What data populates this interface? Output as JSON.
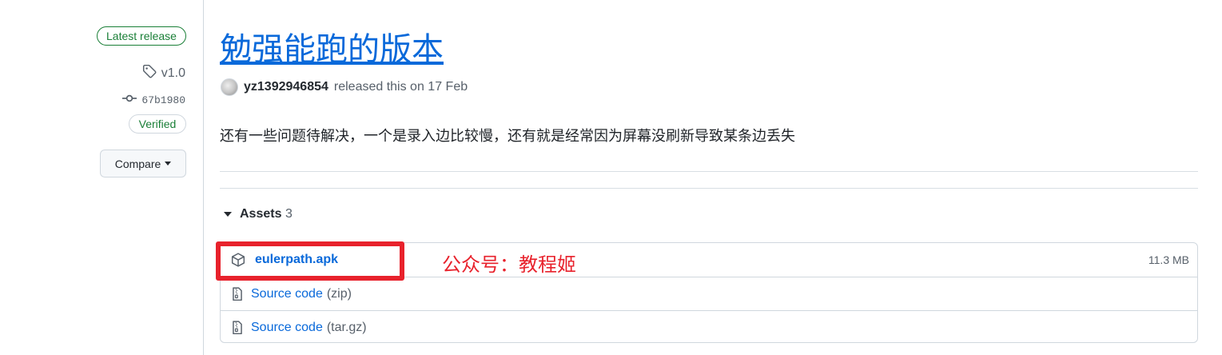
{
  "sidebar": {
    "latest_badge": "Latest release",
    "tag": "v1.0",
    "commit": "67b1980",
    "verified_badge": "Verified",
    "compare_label": "Compare"
  },
  "release": {
    "title": "勉强能跑的版本",
    "author": "yz1392946854",
    "released_text": "released this on 17 Feb",
    "body": "还有一些问题待解决，一个是录入边比较慢，还有就是经常因为屏幕没刷新导致某条边丢失"
  },
  "assets": {
    "label": "Assets",
    "count": "3",
    "items": [
      {
        "name": "eulerpath.apk",
        "ext": "",
        "size": "11.3 MB",
        "icon": "package-icon"
      },
      {
        "name": "Source code",
        "ext": "(zip)",
        "size": "",
        "icon": "file-zip-icon"
      },
      {
        "name": "Source code",
        "ext": "(tar.gz)",
        "size": "",
        "icon": "file-zip-icon"
      }
    ]
  },
  "annotation": {
    "watermark": "公众号：教程姬",
    "highlight_color": "#e8222c"
  },
  "colors": {
    "link": "#0969da",
    "success": "#1a7f37",
    "muted": "#57606a",
    "border": "#d0d7de"
  }
}
